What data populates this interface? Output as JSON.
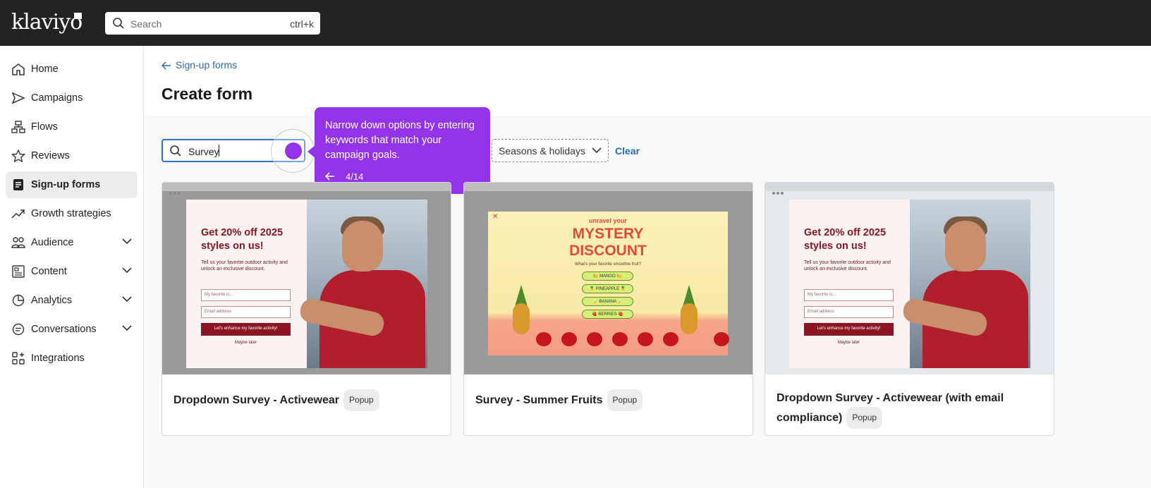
{
  "app": {
    "logo": "klaviyo"
  },
  "header": {
    "search_placeholder": "Search",
    "search_shortcut": "ctrl+k"
  },
  "sidebar": {
    "items": [
      {
        "label": "Home",
        "icon": "home-icon"
      },
      {
        "label": "Campaigns",
        "icon": "send-icon"
      },
      {
        "label": "Flows",
        "icon": "flows-icon"
      },
      {
        "label": "Reviews",
        "icon": "star-icon"
      },
      {
        "label": "Sign-up forms",
        "icon": "form-icon",
        "active": true
      },
      {
        "label": "Growth strategies",
        "icon": "trend-up-icon"
      },
      {
        "label": "Audience",
        "icon": "audience-icon",
        "expandable": true
      },
      {
        "label": "Content",
        "icon": "content-icon",
        "expandable": true
      },
      {
        "label": "Analytics",
        "icon": "pie-chart-icon",
        "expandable": true
      },
      {
        "label": "Conversations",
        "icon": "chat-icon",
        "expandable": true
      },
      {
        "label": "Integrations",
        "icon": "integrations-icon"
      }
    ]
  },
  "page": {
    "breadcrumb": "Sign-up forms",
    "title": "Create form"
  },
  "filters": {
    "search_value": "Survey",
    "category_dropdown": "Seasons & holidays",
    "clear_label": "Clear"
  },
  "tooltip": {
    "message": "Narrow down options by entering keywords that match your campaign goals.",
    "step": "4/14"
  },
  "cards": [
    {
      "name": "Dropdown Survey - Activewear",
      "badge": "Popup",
      "preview": {
        "headline": "Get 20% off 2025 styles on us!",
        "text": "Tell us your favorite outdoor activity and unlock an exclusive discount.",
        "select": "My favorite is...",
        "email": "Email address",
        "button": "Let's enhance my favorite activity!",
        "later": "Maybe later"
      }
    },
    {
      "name": "Survey - Summer Fruits",
      "badge": "Popup",
      "preview": {
        "top": "unravel your",
        "headline_1": "MYSTERY",
        "headline_2": "DISCOUNT",
        "question": "What's your favorite smoothie fruit?",
        "options": [
          "🍋 MANGO 🍋",
          "🍍 PINEAPPLE 🍍",
          "🍌 BANANA 🍌",
          "🍓 BERRIES 🍓"
        ]
      }
    },
    {
      "name": "Dropdown Survey - Activewear (with email compliance)",
      "badge": "Popup",
      "preview": {
        "headline": "Get 20% off 2025 styles on us!",
        "text": "Tell us your favorite outdoor activity and unlock an exclusive discount.",
        "select": "My favorite is...",
        "email": "Email address",
        "button": "Let's enhance my favorite activity!",
        "later": "Maybe later"
      }
    }
  ],
  "colors": {
    "topbar": "#232323",
    "accent_link": "#2b6cb0",
    "tooltip": "#9333ea",
    "popup_brand": "#8b1523"
  }
}
